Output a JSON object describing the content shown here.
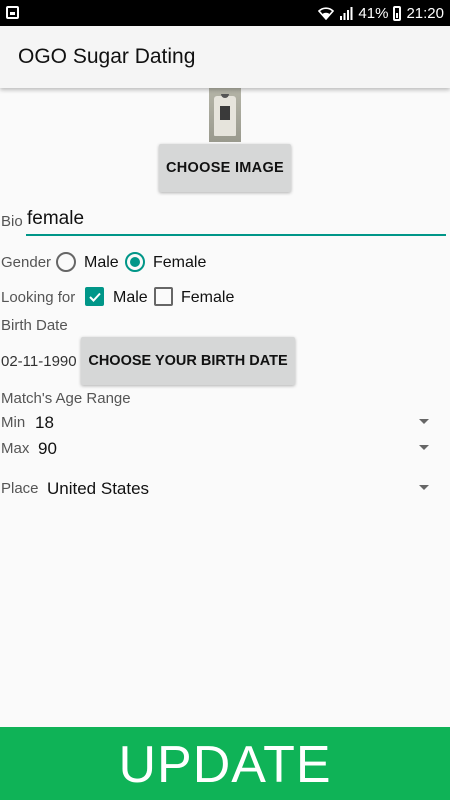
{
  "status_bar": {
    "battery": "41%",
    "time": "21:20"
  },
  "app_bar": {
    "title": "OGO Sugar Dating"
  },
  "image_section": {
    "choose_image_label": "CHOOSE IMAGE"
  },
  "bio": {
    "label": "Bio",
    "value": "female"
  },
  "gender": {
    "label": "Gender",
    "options": [
      "Male",
      "Female"
    ],
    "selected": "Female"
  },
  "looking_for": {
    "label": "Looking for",
    "options": [
      "Male",
      "Female"
    ],
    "checked": [
      "Male"
    ]
  },
  "birth_date": {
    "label": "Birth Date",
    "value": "02-11-1990",
    "button_label": "CHOOSE YOUR BIRTH DATE"
  },
  "age_range": {
    "label": "Match's Age Range",
    "min_label": "Min",
    "min_value": "18",
    "max_label": "Max",
    "max_value": "90"
  },
  "place": {
    "label": "Place",
    "value": "United States"
  },
  "update_button": {
    "label": "UPDATE"
  },
  "colors": {
    "accent": "#009688",
    "update_green": "#0fb357"
  }
}
